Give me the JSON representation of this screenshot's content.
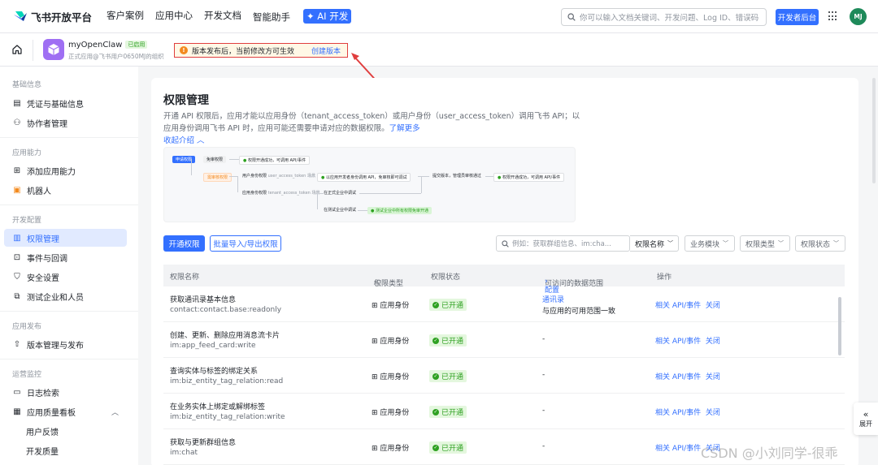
{
  "topbar": {
    "logo_text": "飞书开放平台",
    "nav": [
      "客户案例",
      "应用中心",
      "开发文档",
      "智能助手"
    ],
    "ai_badge": "✦ AI 开发",
    "search_placeholder": "你可以输入文档关键词、开发问题、Log ID、错误码",
    "dev_console": "开发者后台",
    "avatar_initials": "MJ"
  },
  "app": {
    "name": "myOpenClaw",
    "status": "已启用",
    "org": "正式应用@飞书用户0650MJ的组织"
  },
  "notice": {
    "text": "版本发布后，当前修改方可生效",
    "link": "创建版本"
  },
  "sidebar": {
    "sections": {
      "basic": "基础信息",
      "capability": "应用能力",
      "dev_config": "开发配置",
      "release": "应用发布",
      "ops": "运营监控"
    },
    "items": {
      "credentials": "凭证与基础信息",
      "collaborators": "协作者管理",
      "add_capability": "添加应用能力",
      "bot": "机器人",
      "permissions": "权限管理",
      "events": "事件与回调",
      "security": "安全设置",
      "test_enterprise": "测试企业和人员",
      "version": "版本管理与发布",
      "logs": "日志检索",
      "quality": "应用质量看板",
      "user_feedback": "用户反馈",
      "dev_quality": "开发质量"
    }
  },
  "main": {
    "title": "权限管理",
    "description": "开通 API 权限后，应用才能以应用身份（tenant_access_token）或用户身份（user_access_token）调用飞书 API；以应用身份调用飞书 API 时，应用可能还需要申请对应的数据权限。",
    "learn_more": "了解更多",
    "collapse": "收起介绍",
    "flow": {
      "apply": "申请权限",
      "free": "免审权限",
      "free_result": "权限开通成功，可调用 API/事件",
      "review": "需审核权限",
      "user_identity": "用户身份权限",
      "user_token": "user_access_token",
      "app_identity": "应用身份权限",
      "tenant_token": "tenant_access_token",
      "scene": "场景",
      "user_test": "以应用开发者身份调用 API，免审核即可调试",
      "prod_test": "在正式企业中调试",
      "test_ent": "在测试企业中调试",
      "test_ent_result": "测试企业中所有权限免审开通",
      "submit": "提交版本，管理员审核通过",
      "final": "权限开通成功，可调用 API/事件"
    },
    "enable_btn": "开通权限",
    "batch_btn": "批量导入/导出权限",
    "search_placeholder": "例如：获取群组信息、im:cha...",
    "search_by": "权限名称",
    "filters": [
      "业务模块",
      "权限类型",
      "权限状态"
    ],
    "columns": {
      "name": "权限名称",
      "type": "权限类型",
      "status": "权限状态",
      "scope": "可访问的数据范围",
      "scope_config": "配置",
      "ops": "操作"
    },
    "rows": [
      {
        "name": "获取通讯录基本信息",
        "code": "contact:contact.base:readonly",
        "type": "应用身份",
        "status": "已开通",
        "scope_title": "通讯录",
        "scope_desc": "与应用的可用范围一致",
        "op1": "相关 API/事件",
        "op2": "关闭"
      },
      {
        "name": "创建、更新、删除应用消息流卡片",
        "code": "im:app_feed_card:write",
        "type": "应用身份",
        "status": "已开通",
        "scope_title": "-",
        "scope_desc": "",
        "op1": "相关 API/事件",
        "op2": "关闭"
      },
      {
        "name": "查询实体与标签的绑定关系",
        "code": "im:biz_entity_tag_relation:read",
        "type": "应用身份",
        "status": "已开通",
        "scope_title": "-",
        "scope_desc": "",
        "op1": "相关 API/事件",
        "op2": "关闭"
      },
      {
        "name": "在业务实体上绑定或解绑标签",
        "code": "im:biz_entity_tag_relation:write",
        "type": "应用身份",
        "status": "已开通",
        "scope_title": "-",
        "scope_desc": "",
        "op1": "相关 API/事件",
        "op2": "关闭"
      },
      {
        "name": "获取与更新群组信息",
        "code": "im:chat",
        "type": "应用身份",
        "status": "已开通",
        "scope_title": "-",
        "scope_desc": "",
        "op1": "相关 API/事件",
        "op2": "关闭"
      }
    ]
  },
  "expand_label": "展开",
  "watermark": "CSDN @小刘同学-很乖"
}
